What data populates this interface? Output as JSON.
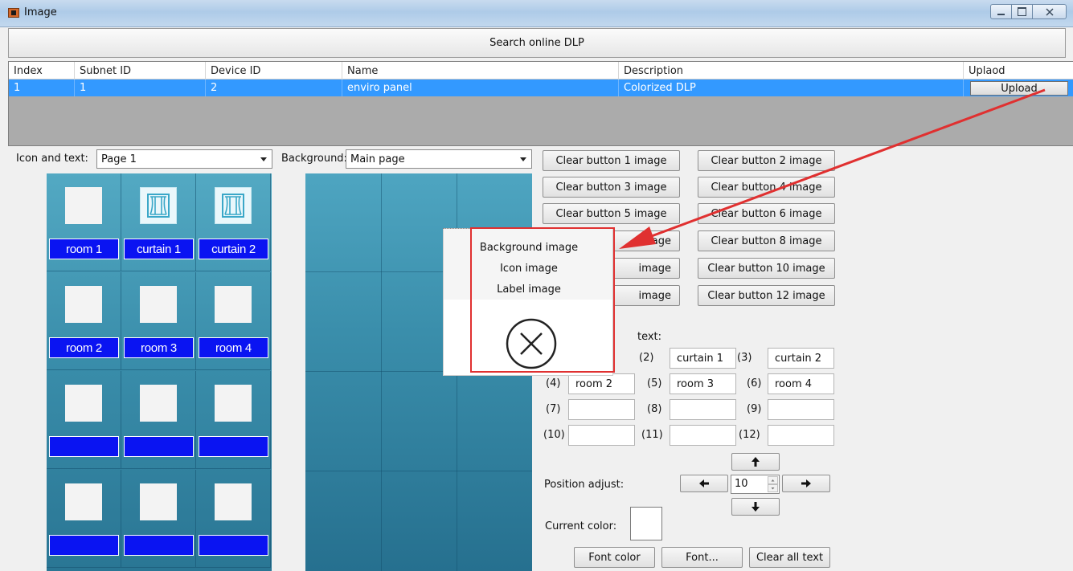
{
  "window": {
    "title": "Image"
  },
  "search": {
    "label": "Search online DLP"
  },
  "device_table": {
    "columns": [
      "Index",
      "Subnet ID",
      "Device ID",
      "Name",
      "Description",
      "Uplaod"
    ],
    "rows": [
      {
        "index": "1",
        "subnet_id": "1",
        "device_id": "2",
        "name": "enviro panel",
        "description": "Colorized DLP",
        "upload_label": "Upload"
      }
    ]
  },
  "icon_text": {
    "label": "Icon and text:",
    "selected": "Page 1"
  },
  "background": {
    "label": "Background:",
    "selected": "Main page"
  },
  "tiles": [
    {
      "label": "room 1",
      "icon": "blank-image"
    },
    {
      "label": "curtain 1",
      "icon": "curtain-icon"
    },
    {
      "label": "curtain 2",
      "icon": "curtain-icon"
    },
    {
      "label": "room 2",
      "icon": "blank-image"
    },
    {
      "label": "room 3",
      "icon": "blank-image"
    },
    {
      "label": "room 4",
      "icon": "blank-image"
    },
    {
      "label": "",
      "icon": "blank-image"
    },
    {
      "label": "",
      "icon": "blank-image"
    },
    {
      "label": "",
      "icon": "blank-image"
    },
    {
      "label": "",
      "icon": "blank-image"
    },
    {
      "label": "",
      "icon": "blank-image"
    },
    {
      "label": "",
      "icon": "blank-image"
    }
  ],
  "clear_buttons": [
    "Clear button 1 image",
    "Clear button 2 image",
    "Clear button 3 image",
    "Clear button 4 image",
    "Clear button 5 image",
    "Clear button 6 image",
    "image",
    "Clear button 8 image",
    "image",
    "Clear button 10 image",
    "image",
    "Clear button 12 image"
  ],
  "popup_menu": {
    "items": [
      "Background image",
      "Icon image",
      "Label image"
    ],
    "close_icon": "close-circle-icon"
  },
  "text_section": {
    "label": "text:",
    "fields": [
      {
        "num": "(2)",
        "value": "curtain 1"
      },
      {
        "num": "(3)",
        "value": "curtain 2"
      },
      {
        "num": "(4)",
        "value": "room 2"
      },
      {
        "num": "(5)",
        "value": "room 3"
      },
      {
        "num": "(6)",
        "value": "room 4"
      },
      {
        "num": "(7)",
        "value": ""
      },
      {
        "num": "(8)",
        "value": ""
      },
      {
        "num": "(9)",
        "value": ""
      },
      {
        "num": "(10)",
        "value": ""
      },
      {
        "num": "(11)",
        "value": ""
      },
      {
        "num": "(12)",
        "value": ""
      }
    ]
  },
  "position_adjust": {
    "label": "Position adjust:",
    "value": "10"
  },
  "current_color": {
    "label": "Current color:",
    "color": "#ffffff"
  },
  "bottom_buttons": {
    "font_color": "Font color",
    "font": "Font...",
    "clear_all": "Clear all text"
  },
  "colors": {
    "selection": "#3399ff",
    "tile_label": "#0a14f2",
    "annotation": "#e03030"
  }
}
